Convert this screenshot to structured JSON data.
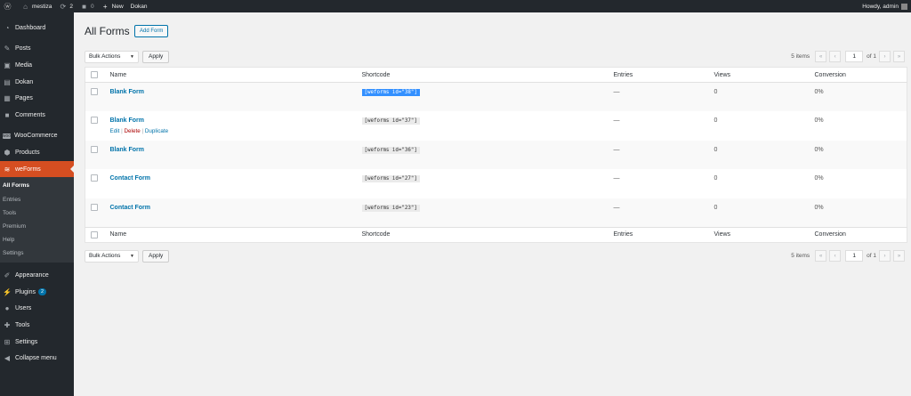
{
  "adminbar": {
    "site_name": "mestiza",
    "updates_count": "2",
    "comments_count": "0",
    "new_label": "New",
    "dokan_label": "Dokan",
    "howdy": "Howdy, admin"
  },
  "sidebar": {
    "items": [
      {
        "label": "Dashboard",
        "icon": "dashboard-icon"
      },
      {
        "label": "Posts",
        "icon": "pin-icon"
      },
      {
        "label": "Media",
        "icon": "media-icon"
      },
      {
        "label": "Dokan",
        "icon": "dokan-icon"
      },
      {
        "label": "Pages",
        "icon": "pages-icon"
      },
      {
        "label": "Comments",
        "icon": "comments-icon"
      },
      {
        "label": "WooCommerce",
        "icon": "woocommerce-icon"
      },
      {
        "label": "Products",
        "icon": "products-icon"
      },
      {
        "label": "weForms",
        "icon": "weforms-icon"
      },
      {
        "label": "Appearance",
        "icon": "appearance-icon"
      },
      {
        "label": "Plugins",
        "icon": "plugins-icon",
        "badge": "2"
      },
      {
        "label": "Users",
        "icon": "users-icon"
      },
      {
        "label": "Tools",
        "icon": "tools-icon"
      },
      {
        "label": "Settings",
        "icon": "settings-icon"
      },
      {
        "label": "Collapse menu",
        "icon": "collapse-icon"
      }
    ],
    "submenu": [
      "All Forms",
      "Entries",
      "Tools",
      "Premium",
      "Help",
      "Settings"
    ]
  },
  "page": {
    "title": "All Forms",
    "add_button": "Add Form"
  },
  "tablenav": {
    "bulk_actions": "Bulk Actions",
    "apply": "Apply",
    "items_count": "5 items",
    "first": "«",
    "prev": "‹",
    "current_page": "1",
    "of_pages": "of 1",
    "next": "›",
    "last": "»"
  },
  "table": {
    "columns": [
      "Name",
      "Shortcode",
      "Entries",
      "Views",
      "Conversion"
    ],
    "rows": [
      {
        "name": "Blank Form",
        "shortcode": "[weforms id=\"38\"]",
        "entries": "—",
        "views": "0",
        "conversion": "0%"
      },
      {
        "name": "Blank Form",
        "shortcode": "[weforms id=\"37\"]",
        "entries": "—",
        "views": "0",
        "conversion": "0%"
      },
      {
        "name": "Blank Form",
        "shortcode": "[weforms id=\"36\"]",
        "entries": "—",
        "views": "0",
        "conversion": "0%"
      },
      {
        "name": "Contact Form",
        "shortcode": "[weforms id=\"27\"]",
        "entries": "—",
        "views": "0",
        "conversion": "0%"
      },
      {
        "name": "Contact Form",
        "shortcode": "[weforms id=\"23\"]",
        "entries": "—",
        "views": "0",
        "conversion": "0%"
      }
    ],
    "row_actions": {
      "edit": "Edit",
      "delete": "Delete",
      "duplicate": "Duplicate"
    }
  }
}
